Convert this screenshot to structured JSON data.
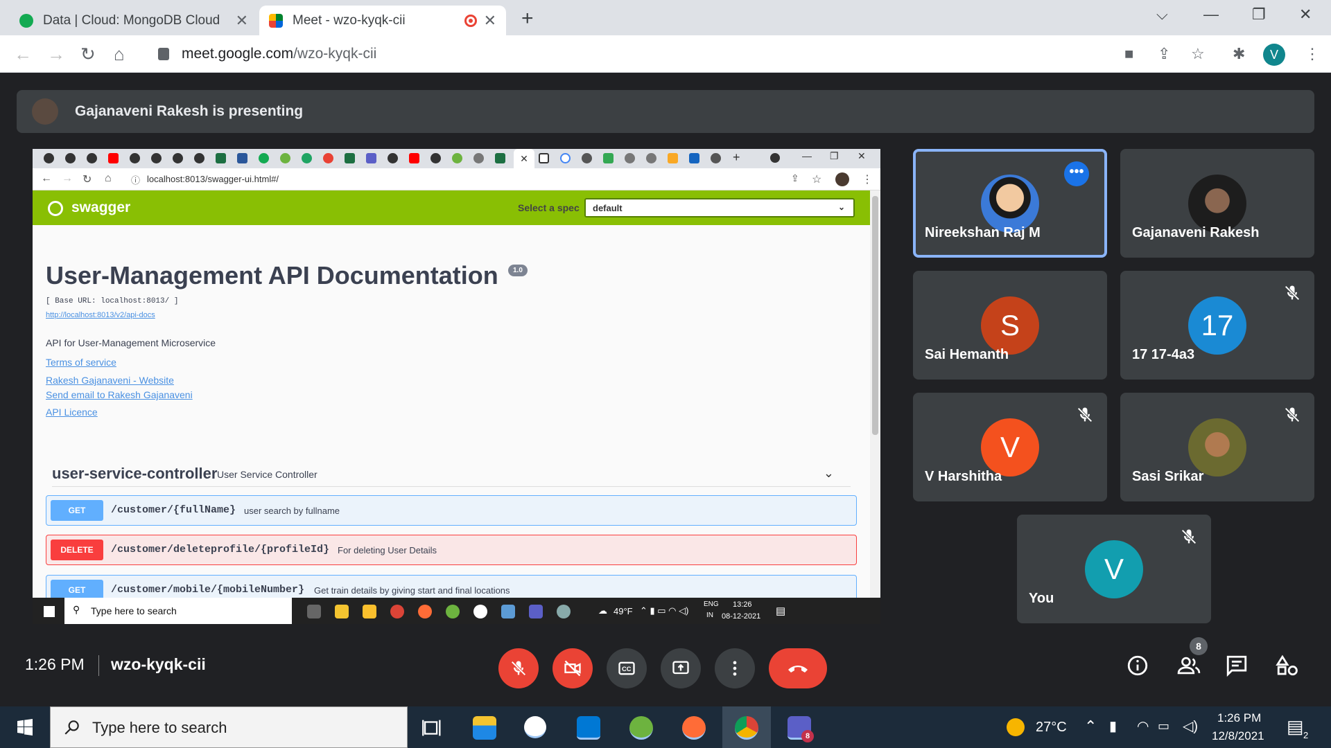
{
  "browser": {
    "tabs": [
      {
        "title": "Data | Cloud: MongoDB Cloud",
        "icon": "mongodb-leaf-icon"
      },
      {
        "title": "Meet - wzo-kyqk-cii",
        "icon": "google-meet-icon",
        "recording": true
      }
    ],
    "url_host": "meet.google.com",
    "url_path": "/wzo-kyqk-cii",
    "profile_initial": "V"
  },
  "presenting": {
    "text": "Gajanaveni Rakesh is presenting"
  },
  "shared_screen": {
    "url": "localhost:8013/swagger-ui.html#/",
    "swagger": {
      "brand": "swagger",
      "select_spec_label": "Select a spec",
      "select_spec_value": "default",
      "title": "User-Management API Documentation",
      "version": "1.0",
      "base_url": "[ Base URL: localhost:8013/ ]",
      "api_docs_link": "http://localhost:8013/v2/api-docs",
      "description": "API for User-Management Microservice",
      "links": [
        "Terms of service",
        "Rakesh Gajanaveni - Website",
        "Send email to Rakesh Gajanaveni",
        "API Licence"
      ],
      "controller": {
        "name": "user-service-controller",
        "description": "User Service Controller"
      },
      "operations": [
        {
          "method": "GET",
          "path": "/customer/{fullName}",
          "summary": "user search by fullname"
        },
        {
          "method": "DELETE",
          "path": "/customer/deleteprofile/{profileId}",
          "summary": "For deleting User Details"
        },
        {
          "method": "GET",
          "path": "/customer/mobile/{mobileNumber}",
          "summary": "Get train details by giving start and final locations"
        }
      ]
    },
    "taskbar": {
      "search_placeholder": "Type here to search",
      "weather": "49°F",
      "lang": "ENG",
      "region": "IN",
      "time": "13:26",
      "date": "08-12-2021"
    }
  },
  "participants": [
    {
      "name": "Nireekshan Raj M",
      "speaking": true,
      "more_options": true
    },
    {
      "name": "Gajanaveni Rakesh"
    },
    {
      "name": "Sai Hemanth",
      "initial": "S",
      "color": "#c5421a"
    },
    {
      "name": "17 17-4a3",
      "initial": "17",
      "color": "#1a8ad4",
      "muted": true
    },
    {
      "name": "V Harshitha",
      "initial": "V",
      "color": "#f4511e",
      "muted": true
    },
    {
      "name": "Sasi Srikar",
      "muted": true
    },
    {
      "name": "You",
      "initial": "V",
      "color": "#129eaf",
      "muted": true
    }
  ],
  "meeting": {
    "time": "1:26 PM",
    "code": "wzo-kyqk-cii",
    "participant_count": "8"
  },
  "taskbar": {
    "search_placeholder": "Type here to search",
    "temperature": "27°C",
    "time": "1:26 PM",
    "date": "12/8/2021",
    "notification_count": "2",
    "teams_badge": "8"
  }
}
